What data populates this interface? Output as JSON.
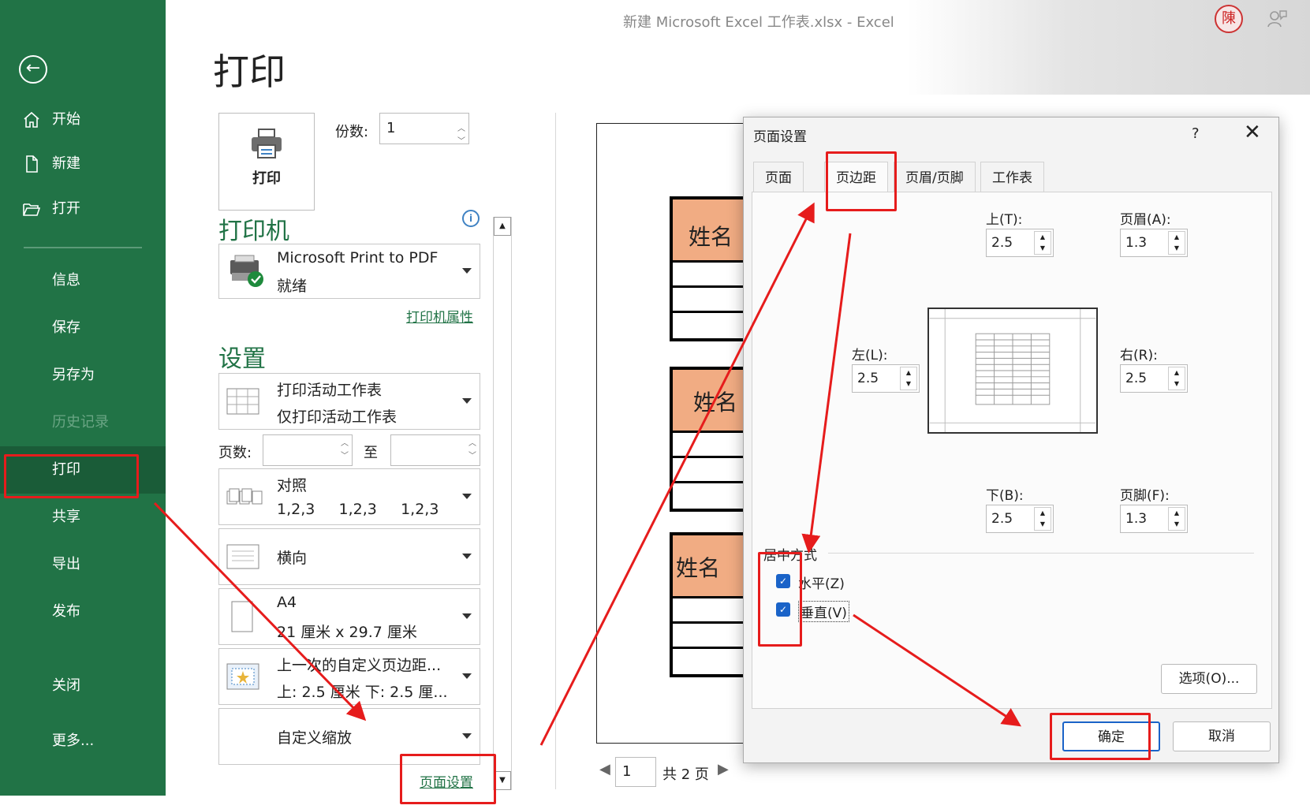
{
  "window": {
    "title": "新建 Microsoft Excel 工作表.xlsx  -  Excel",
    "seal_text": "陳"
  },
  "nav": {
    "back_label": "←",
    "items": [
      {
        "label": "开始"
      },
      {
        "label": "新建"
      },
      {
        "label": "打开"
      },
      {
        "label": "信息"
      },
      {
        "label": "保存"
      },
      {
        "label": "另存为"
      },
      {
        "label": "历史记录"
      },
      {
        "label": "打印"
      },
      {
        "label": "共享"
      },
      {
        "label": "导出"
      },
      {
        "label": "发布"
      },
      {
        "label": "关闭"
      },
      {
        "label": "更多..."
      }
    ],
    "colors": {
      "bg": "#217346",
      "active": "#1a5c38"
    }
  },
  "print": {
    "title": "打印",
    "button_label": "打印",
    "copies_label": "份数:",
    "copies_value": "1",
    "printer_heading": "打印机",
    "printer_name": "Microsoft Print to PDF",
    "printer_status": "就绪",
    "printer_props": "打印机属性",
    "info_icon": "i",
    "settings_heading": "设置",
    "what_main": "打印活动工作表",
    "what_sub": "仅打印活动工作表",
    "pages_label": "页数:",
    "pages_to_label": "至",
    "collate_main": "对照",
    "collate_sub": "1,2,3     1,2,3     1,2,3",
    "orientation": "横向",
    "paper_main": "A4",
    "paper_sub": "21 厘米 x 29.7 厘米",
    "margins_main": "上一次的自定义页边距...",
    "margins_sub": "上: 2.5 厘米 下: 2.5 厘...",
    "scaling": "自定义缩放",
    "page_setup_link": "页面设置"
  },
  "preview": {
    "header_cell": "姓名",
    "page_current": "1",
    "page_total": "共 2 页"
  },
  "dialog": {
    "title": "页面设置",
    "help": "?",
    "close": "✕",
    "tabs": [
      "页面",
      "页边距",
      "页眉/页脚",
      "工作表"
    ],
    "active_tab": "页边距",
    "top_label": "上(T):",
    "top_value": "2.5",
    "header_label": "页眉(A):",
    "header_value": "1.3",
    "left_label": "左(L):",
    "left_value": "2.5",
    "right_label": "右(R):",
    "right_value": "2.5",
    "bottom_label": "下(B):",
    "bottom_value": "2.5",
    "footer_label": "页脚(F):",
    "footer_value": "1.3",
    "center_group": "居中方式",
    "horizontal": "水平(Z)",
    "horizontal_checked": true,
    "vertical": "垂直(V)",
    "vertical_checked": true,
    "options": "选项(O)...",
    "ok": "确定",
    "cancel": "取消"
  },
  "annotation_color": "#e61c1c"
}
